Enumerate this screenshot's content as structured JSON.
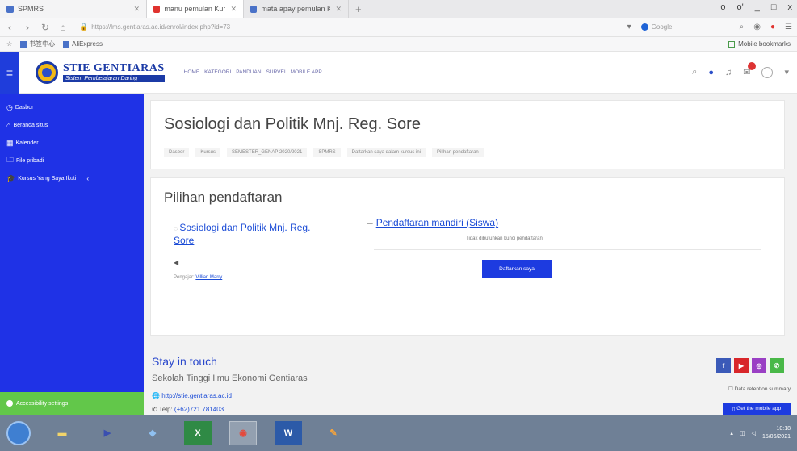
{
  "browser": {
    "tabs": [
      {
        "label": "SPMRS",
        "favicon_color": "#4a72c8"
      },
      {
        "label": "manu pemulan Kursus pada...",
        "favicon_color": "#e0332f"
      },
      {
        "label": "mata apay pemulan Kursus...",
        "favicon_color": "#4a72c8"
      }
    ],
    "new_tab_glyph": "+",
    "window_controls": [
      "o",
      "o'",
      "_",
      "□",
      "x"
    ],
    "url": "https://lms.gentiaras.ac.id/enrol/index.php?id=73",
    "search_engine": "Google",
    "bookmarks": [
      "书签中心",
      "AliExpress"
    ],
    "mobile_bookmarks": "Mobile bookmarks"
  },
  "site": {
    "brand": "STIE GENTIARAS",
    "tagline": "Sistem Pembelajaran Daring",
    "menu": [
      "HOME",
      "KATEGORI",
      "PANDUAN",
      "SURVEI",
      "MOBILE APP"
    ]
  },
  "sidebar": {
    "items": [
      {
        "icon": "dashboard-icon",
        "glyph": "◷",
        "label": "Dasbor"
      },
      {
        "icon": "home-icon",
        "glyph": "⌂",
        "label": "Beranda situs"
      },
      {
        "icon": "calendar-icon",
        "glyph": "▦",
        "label": "Kalender"
      },
      {
        "icon": "file-icon",
        "glyph": "🗀",
        "label": "File pribadi"
      },
      {
        "icon": "graduation-cap-icon",
        "glyph": "🎓",
        "label": "Kursus Yang Saya Ikuti",
        "caret": "‹"
      }
    ],
    "accessibility": "Accessibility settings"
  },
  "page": {
    "title": "Sosiologi dan Politik Mnj. Reg. Sore",
    "breadcrumb": [
      "Dasbor",
      "Kursus",
      "SEMESTER_GENAP 2020/2021",
      "SPMRS",
      "Daftarkan saya dalam kursus ini",
      "Pilihan pendaftaran"
    ]
  },
  "enrol": {
    "heading": "Pilihan pendaftaran",
    "course_link": "Sosiologi dan Politik Mnj. Reg. Sore",
    "teacher_label": "Pengajar:",
    "teacher_name": "Villian Marry",
    "method": "Pendaftaran mandiri (Siswa)",
    "note": "Tidak dibutuhkan kunci pendaftaran.",
    "button": "Daftarkan saya"
  },
  "footer": {
    "title": "Stay in touch",
    "school": "Sekolah Tinggi Ilmu Ekonomi Gentiaras",
    "web": "http://stie.gentiaras.ac.id",
    "phone_label": "Telp:",
    "phone": "(+62)721 781403",
    "retention": "Data retention summary",
    "mobile_app": "Get the mobile app",
    "socials": [
      {
        "name": "facebook",
        "glyph": "f",
        "color": "#3b5ab8"
      },
      {
        "name": "youtube",
        "glyph": "▶",
        "color": "#d8262a"
      },
      {
        "name": "instagram",
        "glyph": "◎",
        "color": "#9a3fc4"
      },
      {
        "name": "whatsapp",
        "glyph": "✆",
        "color": "#49b848"
      }
    ]
  },
  "taskbar": {
    "time": "10:18",
    "date": "15/06/2021"
  }
}
